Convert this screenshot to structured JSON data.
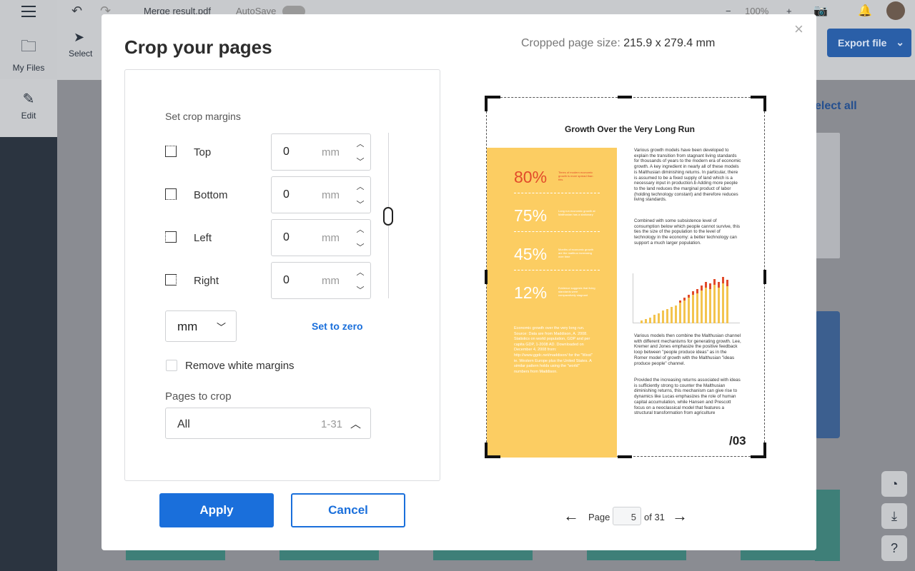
{
  "app": {
    "file_name": "Merge result.pdf",
    "autosave_label": "AutoSave",
    "zoom": "100%",
    "nav": {
      "files_label": "My Files",
      "edit_label": "Edit",
      "select_label": "Select"
    },
    "export_label": "Export file",
    "select_all_label": "elect all"
  },
  "modal": {
    "title": "Crop your pages",
    "crop_size_label": "Cropped page size:",
    "crop_size_value": "215.9 x 279.4 mm",
    "set_margins_label": "Set crop margins",
    "margins": [
      {
        "label": "Top",
        "value": "0",
        "unit": "mm"
      },
      {
        "label": "Bottom",
        "value": "0",
        "unit": "mm"
      },
      {
        "label": "Left",
        "value": "0",
        "unit": "mm"
      },
      {
        "label": "Right",
        "value": "0",
        "unit": "mm"
      }
    ],
    "unit_select": "mm",
    "set_zero_label": "Set to zero",
    "remove_white_label": "Remove white margins",
    "remove_white_checked": false,
    "pages_label": "Pages to crop",
    "pages_value": "All",
    "pages_range": "1-31",
    "apply_label": "Apply",
    "cancel_label": "Cancel"
  },
  "preview": {
    "title": "Growth Over the Very Long Run",
    "stats": [
      {
        "value": "80%",
        "note": "Times of modern economic growth is more spread than this."
      },
      {
        "value": "75%",
        "note": "Long run economic growth at Malthusian has a stationary"
      },
      {
        "value": "45%",
        "note": "Months of economic growth are the malthus increasing over time"
      },
      {
        "value": "12%",
        "note": "Evidence suggests that living standards were comparatively stagnant"
      }
    ],
    "footnote": "Economic growth over the very long run. Source: Data are from Maddison, A. 2008. Statistics on world population, GDP and per capita GDP, 1-2008 AD. Downloaded on December 4, 2008 from: http://www.ggdc.net/maddison/ for the \"West\" ie. Western Europe plus the United States. A similar pattern holds using the \"world\" numbers from Maddison.",
    "col1": "Various growth models have been developed to explain the transition from stagnant living standards for thousands of years to the modern era of economic growth. A key ingredient in nearly all of these models is Malthusian diminishing returns. In particular, there is assumed to be a fixed supply of land which is a necessary input in production.b Adding more people to the land reduces the marginal product of labor (holding technology constant) and therefore reduces living standards.",
    "col2": "Combined with some subsistence level of consumption below which people cannot survive, this ties the size of the population to the level of technology in the economy: a better technology can support a much larger population.",
    "col3": "Various models then combine the Malthusian channel with different mechanisms for generating growth. Lee, Kremer and Jones emphasize the positive feedback loop between \"people produce ideas\" as in the Romer model of growth with the Malthusian \"ideas produce people\" channel.",
    "col4": "Provided the increasing returns associated with ideas is sufficiently strong to counter the Malthusian diminishing returns, this mechanism can give rise to dynamics like Lucas emphasizes the role of human capital accumulation, while Hansen and Prescott focus on a neoclassical model that features a structural transformation from agriculture",
    "chart_ticks": [
      "0.06",
      "0.05",
      "0.04",
      "0.03",
      "0.02",
      "0.01",
      "0.00"
    ],
    "page_marker": "/03"
  },
  "pager": {
    "page_label": "Page",
    "current": "5",
    "total_label": "of 31"
  },
  "colors": {
    "accent": "#1a6fdb",
    "yellow": "#fccd62",
    "red": "#e24b2a"
  }
}
